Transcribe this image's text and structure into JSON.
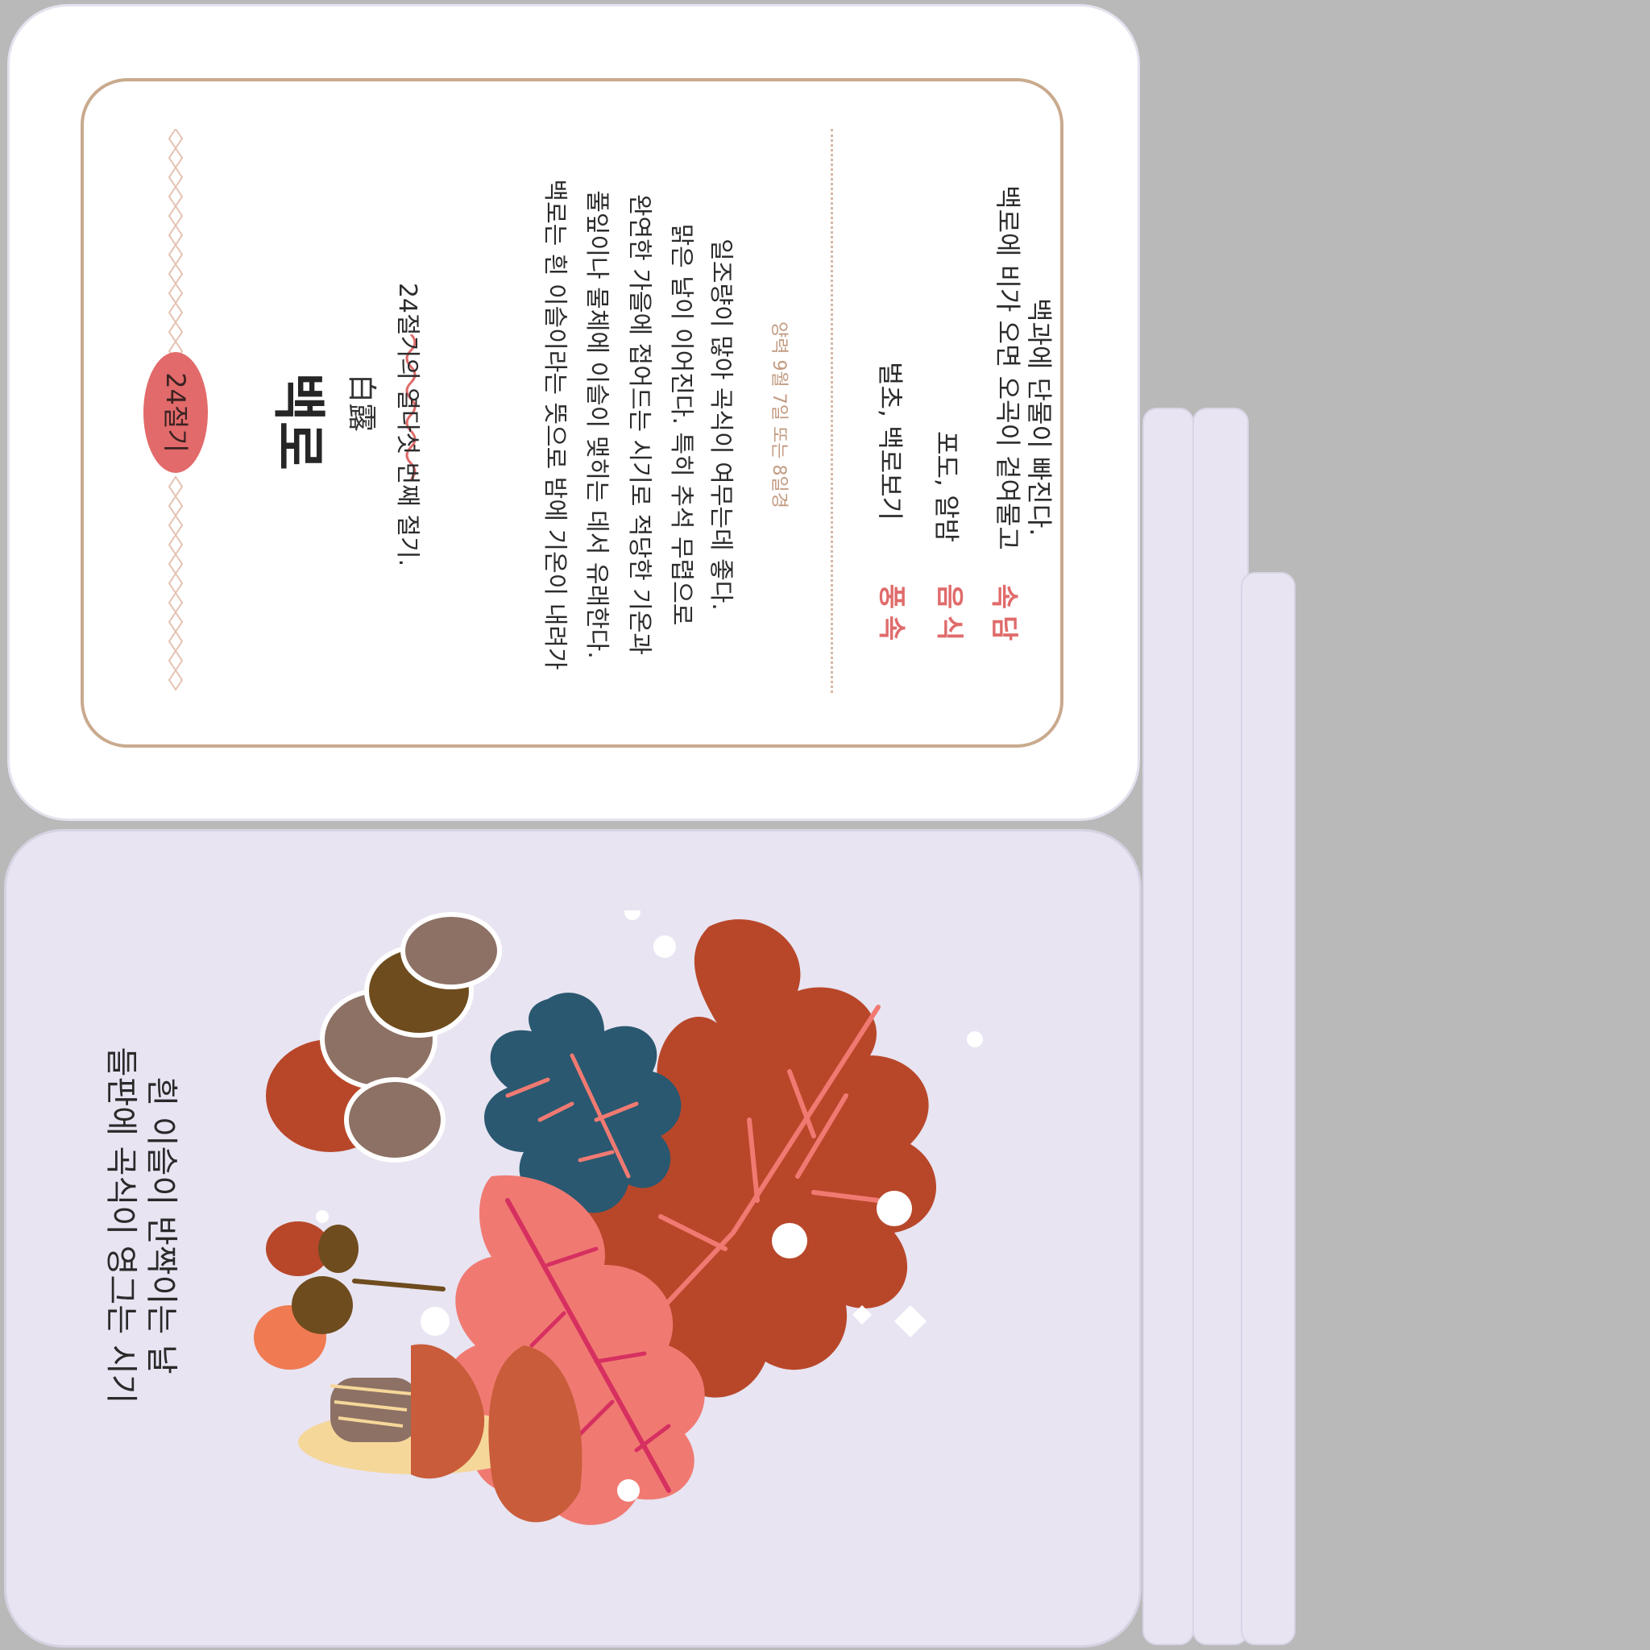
{
  "top_card": {
    "badge": "24절기",
    "title": "백로",
    "hanja": "白露",
    "lines": [
      "24절기의 열다섯 번째 절기.",
      "백로는 흰 이슬이라는 뜻으로 밤에 기온이 내려가",
      "풀잎이나 물체에 이슬이 맺히는 데서 유래한다.",
      "완연한 가을에 접어드는 시기로 적당한 기온과",
      "맑은 날이 이어진다. 특히 추석 무렵으로",
      "일조량이 많아 곡식이 여무는데 좋다."
    ],
    "date_note": "양력 9월 7일 또는 8일경",
    "customs": [
      {
        "label": "풍속",
        "value": "벌초, 백로보기"
      },
      {
        "label": "음식",
        "value": "포도, 알밤"
      },
      {
        "label": "속담",
        "value": "백로에 비가 오면 오곡이 겉여물고",
        "value2": "백과에 단물이 빠진다."
      }
    ]
  },
  "bottom_card": {
    "caption_line1": "들판에 곡식이 영그는 시기",
    "caption_line2": "흰 이슬이 반짝이는 날"
  },
  "colors": {
    "accent_red": "#e06b6b",
    "badge": "#e26a6a",
    "tan": "#c9aa8e",
    "rust": "#b8472a",
    "navy": "#2a5870",
    "salmon": "#f07a72",
    "brown": "#6e4c1e",
    "taupe": "#8d7165",
    "lilac": "#e8e4f2"
  },
  "icons": [
    "oak-leaf-icon",
    "acorn-icon",
    "pine-cone-icon",
    "mushroom-icon",
    "dotted-divider-icon"
  ]
}
